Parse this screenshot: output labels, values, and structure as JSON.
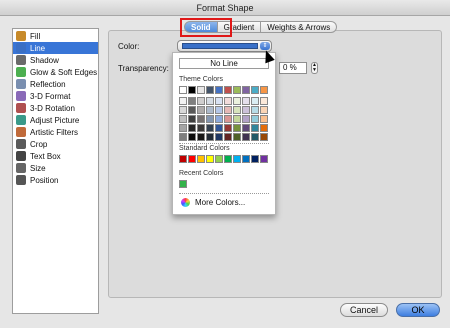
{
  "window": {
    "title": "Format Shape"
  },
  "sidebar": {
    "items": [
      {
        "label": "Fill",
        "icon": "paint-bucket-icon",
        "selected": false
      },
      {
        "label": "Line",
        "icon": "line-icon",
        "selected": true
      },
      {
        "label": "Shadow",
        "icon": "shadow-icon",
        "selected": false
      },
      {
        "label": "Glow & Soft Edges",
        "icon": "glow-icon",
        "selected": false
      },
      {
        "label": "Reflection",
        "icon": "reflection-icon",
        "selected": false
      },
      {
        "label": "3-D Format",
        "icon": "3d-format-icon",
        "selected": false
      },
      {
        "label": "3-D Rotation",
        "icon": "3d-rotation-icon",
        "selected": false
      },
      {
        "label": "Adjust Picture",
        "icon": "adjust-picture-icon",
        "selected": false
      },
      {
        "label": "Artistic Filters",
        "icon": "artistic-filters-icon",
        "selected": false
      },
      {
        "label": "Crop",
        "icon": "crop-icon",
        "selected": false
      },
      {
        "label": "Text Box",
        "icon": "text-box-icon",
        "selected": false
      },
      {
        "label": "Size",
        "icon": "size-icon",
        "selected": false
      },
      {
        "label": "Position",
        "icon": "position-icon",
        "selected": false
      }
    ]
  },
  "tabs": [
    {
      "label": "Solid",
      "active": true
    },
    {
      "label": "Gradient",
      "active": false
    },
    {
      "label": "Weights & Arrows",
      "active": false
    }
  ],
  "form": {
    "color_label": "Color:",
    "transparency_label": "Transparency:",
    "transparency_value": "0 %",
    "current_color": "#3970c8"
  },
  "popup": {
    "no_line_label": "No Line",
    "theme_colors_title": "Theme Colors",
    "theme_top_row": [
      "#ffffff",
      "#000000",
      "#e7e6e6",
      "#44546a",
      "#4472c4",
      "#c0504d",
      "#9bbb59",
      "#8064a2",
      "#4bacc6",
      "#f79646"
    ],
    "theme_shades": [
      [
        "#f2f2f2",
        "#7f7f7f",
        "#d0cece",
        "#d6dce4",
        "#d9e2f3",
        "#f2dcdb",
        "#ebf1dd",
        "#e5e0ec",
        "#dbeef3",
        "#fdeada"
      ],
      [
        "#d8d8d8",
        "#595959",
        "#aeabab",
        "#adb9ca",
        "#b4c6e7",
        "#e5b9b7",
        "#d7e3bc",
        "#ccc1d9",
        "#b7dde8",
        "#fbd5b5"
      ],
      [
        "#bfbfbf",
        "#3f3f3f",
        "#757070",
        "#8496b0",
        "#8eaadb",
        "#d99694",
        "#c3d69b",
        "#b2a2c7",
        "#92cddc",
        "#fac08f"
      ],
      [
        "#a5a5a5",
        "#262626",
        "#3a3838",
        "#323f4f",
        "#2f5496",
        "#953734",
        "#76923c",
        "#5f497a",
        "#31859b",
        "#e36c09"
      ],
      [
        "#7f7f7f",
        "#0c0c0c",
        "#171616",
        "#222a35",
        "#1f3763",
        "#632423",
        "#4f6128",
        "#3f3151",
        "#205867",
        "#974806"
      ]
    ],
    "standard_colors_title": "Standard Colors",
    "standard_colors": [
      "#c00000",
      "#ff0000",
      "#ffc000",
      "#ffff00",
      "#92d050",
      "#00b050",
      "#00b0f0",
      "#0070c0",
      "#002060",
      "#7030a0"
    ],
    "recent_colors_title": "Recent Colors",
    "recent_colors": [
      "#33b34a"
    ],
    "more_colors_label": "More Colors..."
  },
  "buttons": {
    "cancel": "Cancel",
    "ok": "OK"
  }
}
